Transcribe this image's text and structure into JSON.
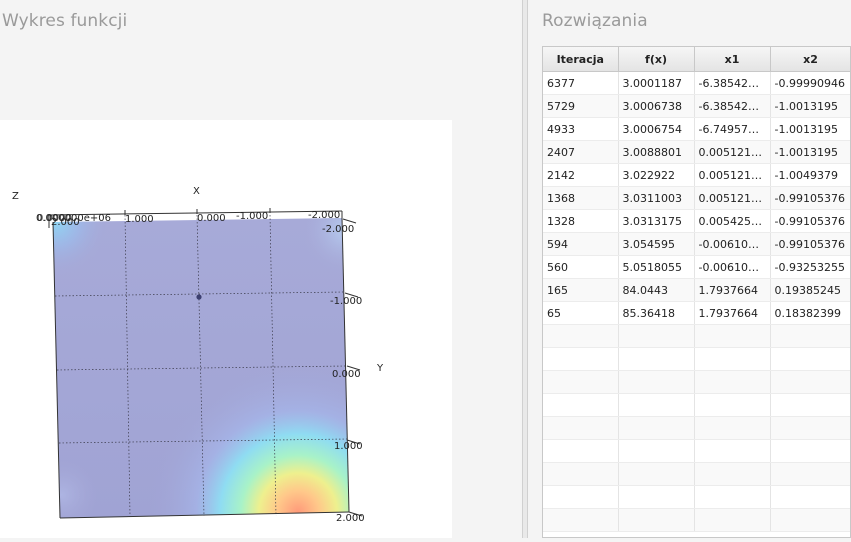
{
  "left_panel": {
    "title": "Wykres funkcji"
  },
  "right_panel": {
    "title": "Rozwiązania"
  },
  "plot": {
    "axis_z_label": "Z",
    "axis_x_label": "X",
    "axis_y_label": "Y",
    "z_ticks_overlap": "0.000000e+06",
    "z_ticks_ghost": "0.0000",
    "x_ticks": [
      "2.000",
      "1.000",
      "0.000",
      "-1.000",
      "-2.000"
    ],
    "y_ticks": [
      "-2.000",
      "-1.000",
      "0.000",
      "1.000",
      "2.000"
    ]
  },
  "table": {
    "columns": [
      "Iteracja",
      "f(x)",
      "x1",
      "x2"
    ],
    "rows": [
      [
        "6377",
        "3.0001187",
        "-6.385423E…",
        "-0.99990946"
      ],
      [
        "5729",
        "3.0006738",
        "-6.385423E…",
        "-1.0013195"
      ],
      [
        "4933",
        "3.0006754",
        "-6.749579E…",
        "-1.0013195"
      ],
      [
        "2407",
        "3.0088801",
        "0.0051216…",
        "-1.0013195"
      ],
      [
        "2142",
        "3.022922",
        "0.0051216…",
        "-1.0049379"
      ],
      [
        "1368",
        "3.0311003",
        "0.0051216…",
        "-0.99105376"
      ],
      [
        "1328",
        "3.0313175",
        "0.0054259…",
        "-0.99105376"
      ],
      [
        "594",
        "3.054595",
        "-0.0061049…",
        "-0.99105376"
      ],
      [
        "560",
        "5.0518055",
        "-0.0061049…",
        "-0.93253255"
      ],
      [
        "165",
        "84.0443",
        "1.7937664",
        "0.19385245"
      ],
      [
        "65",
        "85.36418",
        "1.7937664",
        "0.18382399"
      ]
    ],
    "empty_rows": 9
  }
}
